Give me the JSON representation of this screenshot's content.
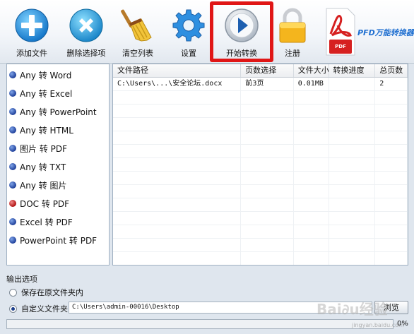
{
  "toolbar": {
    "add_file": "添加文件",
    "remove_selected": "删除选择项",
    "clear_list": "清空列表",
    "settings": "设置",
    "start_convert": "开始转换",
    "register": "注册",
    "brand": "PFD万能转换器",
    "brand_icon_text": "PDF"
  },
  "conversion_types": [
    "Any 转 Word",
    "Any 转 Excel",
    "Any 转 PowerPoint",
    "Any 转 HTML",
    "图片 转 PDF",
    "Any 转 TXT",
    "Any 转 图片",
    "DOC 转 PDF",
    "Excel 转 PDF",
    "PowerPoint 转 PDF"
  ],
  "table": {
    "headers": [
      "文件路径",
      "页数选择",
      "文件大小",
      "转换进度",
      "总页数"
    ],
    "rows": [
      [
        "C:\\Users\\...\\安全论坛.docx",
        "前3页",
        "0.01MB",
        "",
        "2"
      ]
    ]
  },
  "output": {
    "title": "输出选项",
    "option_original": "保存在原文件夹内",
    "option_custom": "自定义文件夹",
    "path": "C:\\Users\\admin-00016\\Desktop",
    "browse": "浏览"
  },
  "progress": {
    "percent": 0,
    "label": "0%"
  },
  "watermark": {
    "main": "Bai∂u经验",
    "sub": "jingyan.baidu.com"
  },
  "colors": {
    "highlight": "#e01616",
    "accent": "#1f6fd0"
  }
}
